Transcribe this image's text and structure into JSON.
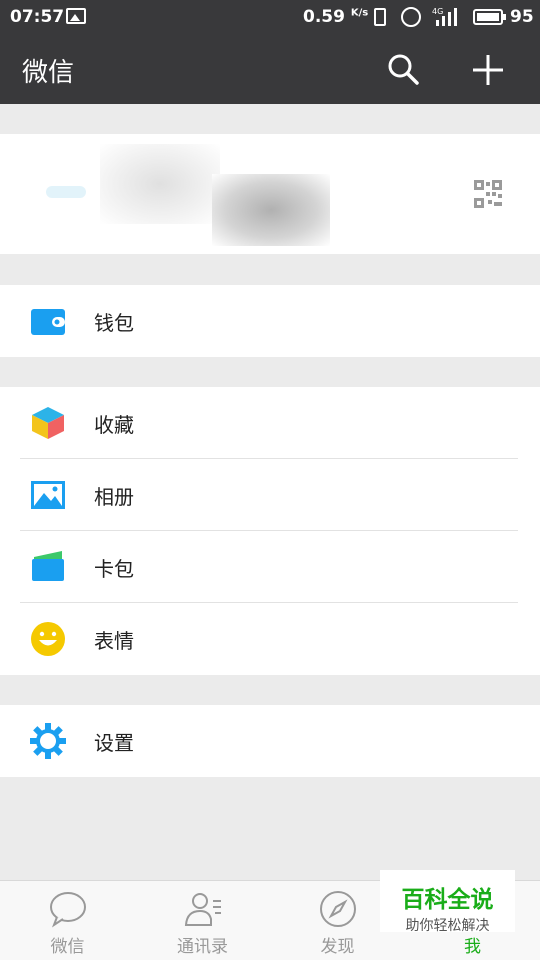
{
  "status_bar": {
    "time": "07:57",
    "net_speed": "0.59",
    "net_unit": "K/s",
    "net_type": "4G",
    "battery": "95"
  },
  "title_bar": {
    "title": "微信"
  },
  "menu": {
    "wallet": "钱包",
    "favorites": "收藏",
    "album": "相册",
    "cards": "卡包",
    "stickers": "表情",
    "settings": "设置"
  },
  "tabs": [
    {
      "label": "微信",
      "icon": "chat-bubble-icon"
    },
    {
      "label": "通讯录",
      "icon": "contacts-icon"
    },
    {
      "label": "发现",
      "icon": "compass-icon"
    },
    {
      "label": "我",
      "icon": "person-icon"
    }
  ],
  "watermark": {
    "title": "百科全说",
    "subtitle": "助你轻松解决"
  },
  "colors": {
    "header_bg": "#39393b",
    "accent_green": "#1aad19",
    "wallet_blue": "#1a9ff0",
    "settings_blue": "#1a9ff0",
    "sticker_yellow": "#f5c900"
  }
}
